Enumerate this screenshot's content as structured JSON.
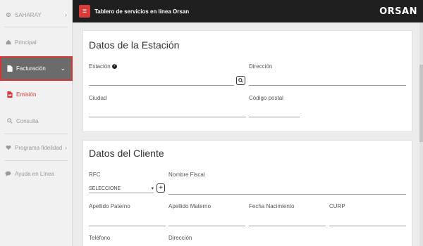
{
  "sidebar": {
    "items": [
      {
        "label": "SAHARAY",
        "icon": "gear-icon"
      },
      {
        "label": "Principal",
        "icon": "home-icon"
      },
      {
        "label": "Facturación",
        "icon": "document-icon"
      },
      {
        "label": "Emisión",
        "icon": "pdf-icon"
      },
      {
        "label": "Consulta",
        "icon": "search-icon"
      },
      {
        "label": "Programa fidelidad",
        "icon": "heart-icon"
      },
      {
        "label": "Ayuda en Línea",
        "icon": "chat-icon"
      }
    ]
  },
  "topbar": {
    "title": "Tablero de servicios en línea Orsan",
    "brand": "ORSAN"
  },
  "station": {
    "title": "Datos de la Estación",
    "station_label": "Estación",
    "address_label": "Dirección",
    "city_label": "Ciudad",
    "postal_label": "Código postal"
  },
  "client": {
    "title": "Datos del Cliente",
    "rfc_label": "RFC",
    "rfc_value": "SELECCIONE",
    "fiscal_name_label": "Nombre Fiscal",
    "paternal_label": "Apellido Paterno",
    "maternal_label": "Apellido Materno",
    "birth_label": "Fecha Nacimiento",
    "curp_label": "CURP",
    "phone_label": "Teléfono",
    "address_label": "Dirección"
  },
  "colors": {
    "accent": "#d93a3a",
    "topbar": "#1f1f1f",
    "sidebar_active": "#6b6b6b"
  }
}
